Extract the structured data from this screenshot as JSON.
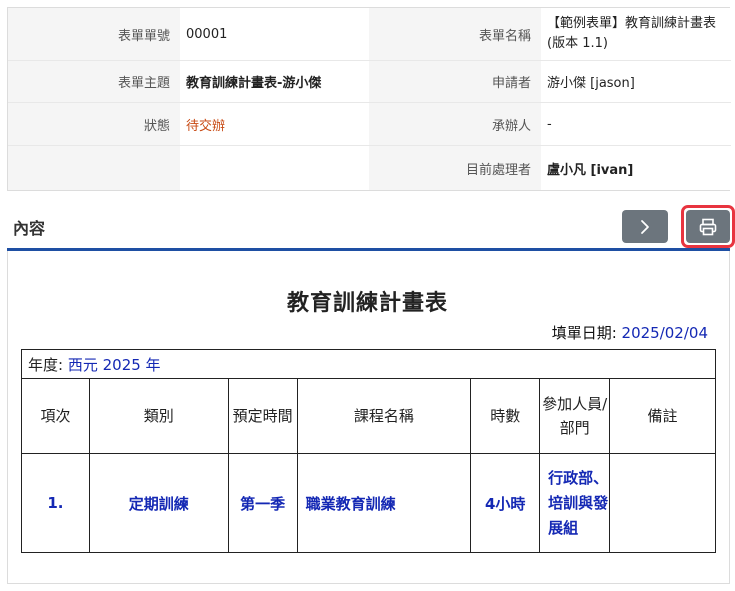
{
  "header": {
    "form_no_label": "表單單號",
    "form_no": "00001",
    "form_name_label": "表單名稱",
    "form_name": "【範例表單】教育訓練計畫表 (版本 1.1)",
    "subject_label": "表單主題",
    "subject": "教育訓練計畫表-游小傑",
    "applicant_label": "申請者",
    "applicant": "游小傑 [jason]",
    "status_label": "狀態",
    "status": "待交辦",
    "handler_label": "承辦人",
    "handler": "-",
    "current_label": "目前處理者",
    "current": "盧小凡 [ivan]"
  },
  "section": {
    "title": "內容",
    "next_icon": "chevron-right-icon",
    "print_icon": "printer-icon"
  },
  "document": {
    "title": "教育訓練計畫表",
    "fill_date_label": "填單日期:",
    "fill_date": "2025/02/04",
    "year_label": "年度:",
    "year_value": "西元 2025 年",
    "columns": [
      "項次",
      "類別",
      "預定時間",
      "課程名稱",
      "時數",
      "參加人員/部門",
      "備註"
    ],
    "rows": [
      {
        "no": "1.",
        "category": "定期訓練",
        "schedule": "第一季",
        "course": "職業教育訓練",
        "hours": "4小時",
        "dept": "行政部、培訓與發展組",
        "note": ""
      }
    ]
  },
  "colors": {
    "accent_rule": "#1e4fa3",
    "status": "#c84a14",
    "value_blue": "#1428b4",
    "button_gray": "#6c757d",
    "highlight_red": "#e8343f"
  }
}
